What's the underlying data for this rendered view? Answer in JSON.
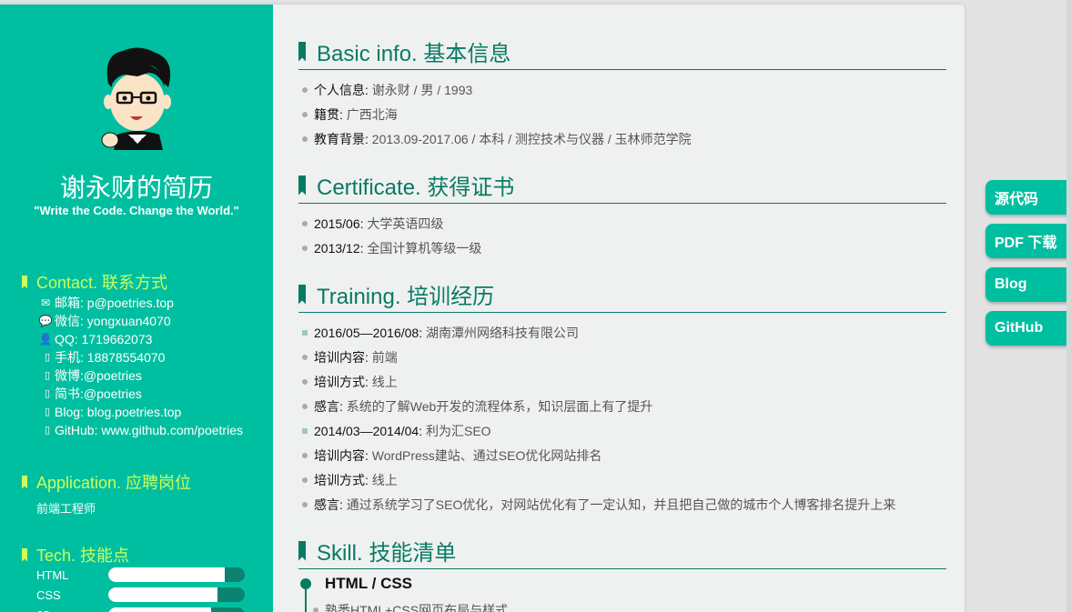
{
  "sidebar": {
    "name": "谢永财的简历",
    "motto": "\"Write the Code. Change the World.\"",
    "contact_heading": "Contact. 联系方式",
    "contacts": [
      {
        "icon": "envelope-icon",
        "glyph": "✉",
        "text": "邮箱: p@poetries.top"
      },
      {
        "icon": "wechat-icon",
        "glyph": "💬",
        "text": "微信: yongxuan4070"
      },
      {
        "icon": "qq-icon",
        "glyph": "👤",
        "text": "QQ: 1719662073"
      },
      {
        "icon": "phone-icon",
        "glyph": "▯",
        "text": "手机: 18878554070"
      },
      {
        "icon": "weibo-icon",
        "glyph": "▯",
        "text": "微博:@poetries"
      },
      {
        "icon": "jianshu-icon",
        "glyph": "▯",
        "text": "简书:@poetries"
      },
      {
        "icon": "blog-icon",
        "glyph": "▯",
        "text": "Blog: blog.poetries.top"
      },
      {
        "icon": "github-icon",
        "glyph": "▯",
        "text": "GitHub: www.github.com/poetries"
      }
    ],
    "application_heading": "Application. 应聘岗位",
    "job": "前端工程师",
    "tech_heading": "Tech. 技能点",
    "skills": [
      {
        "name": "HTML",
        "level": 0.85
      },
      {
        "name": "CSS",
        "level": 0.8
      },
      {
        "name": "JS",
        "level": 0.75
      }
    ]
  },
  "main": {
    "basic": {
      "heading": "Basic info. 基本信息",
      "items": [
        {
          "key": "个人信息",
          "value": "谢永财 / 男 / 1993"
        },
        {
          "key": "籍贯",
          "value": "广西北海"
        },
        {
          "key": "教育背景",
          "value": "2013.09-2017.06 / 本科 / 测控技术与仪器 / 玉林师范学院"
        }
      ]
    },
    "certificate": {
      "heading": "Certificate. 获得证书",
      "items": [
        {
          "key": "2015/06",
          "value": "大学英语四级"
        },
        {
          "key": "2013/12",
          "value": "全国计算机等级一级"
        }
      ]
    },
    "training": {
      "heading": "Training. 培训经历",
      "items": [
        {
          "key": "2016/05—2016/08",
          "value": "湖南潭州网络科技有限公司",
          "marker": "square"
        },
        {
          "key": "培训内容",
          "value": "前端",
          "marker": "dot"
        },
        {
          "key": "培训方式",
          "value": "线上",
          "marker": "dot"
        },
        {
          "key": "感言",
          "value": "系统的了解Web开发的流程体系，知识层面上有了提升",
          "marker": "dot"
        },
        {
          "key": "2014/03—2014/04",
          "value": "利为汇SEO",
          "marker": "square"
        },
        {
          "key": "培训内容",
          "value": "WordPress建站、通过SEO优化网站排名",
          "marker": "dot"
        },
        {
          "key": "培训方式",
          "value": "线上",
          "marker": "dot"
        },
        {
          "key": "感言",
          "value": "通过系统学习了SEO优化，对网站优化有了一定认知，并且把自己做的城市个人博客排名提升上来",
          "marker": "dot"
        }
      ]
    },
    "skill": {
      "heading": "Skill. 技能清单",
      "first_title": "HTML / CSS",
      "first_desc": "熟悉HTML+CSS网页布局与样式"
    }
  },
  "floating_buttons": [
    "源代码",
    "PDF 下载",
    "Blog",
    "GitHub"
  ],
  "colors": {
    "accent": "#00bfa0",
    "heading": "#087a64",
    "sidebar_heading": "#c9ff5b",
    "page_bg": "#eff1f0"
  }
}
